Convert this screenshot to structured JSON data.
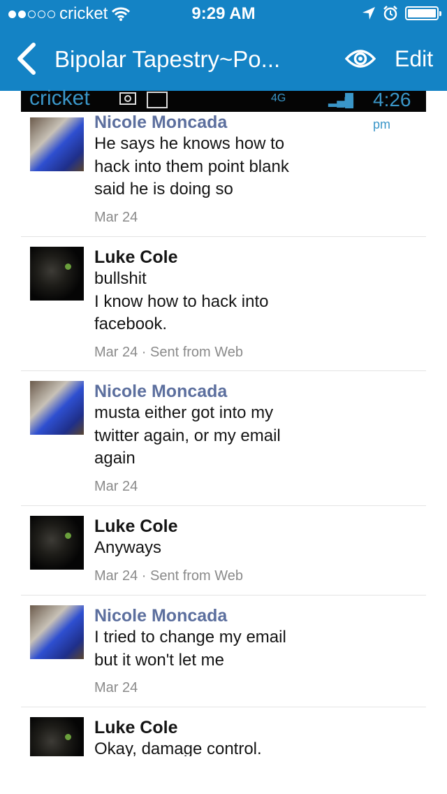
{
  "status_bar": {
    "carrier": "cricket",
    "time": "9:29 AM",
    "signal_dots_filled": 2,
    "signal_dots_total": 5,
    "battery_level": 1.0
  },
  "nav": {
    "title": "Bipolar Tapestry~Po...",
    "edit_label": "Edit"
  },
  "inner_status": {
    "carrier": "cricket",
    "network": "4G",
    "time": "4:26",
    "ampm": "pm"
  },
  "messages": [
    {
      "author": "Nicole Moncada",
      "text": "He says he knows how to\nhack into them point blank\nsaid he is doing so",
      "meta": "Mar 24"
    },
    {
      "author": "Luke Cole",
      "text": "bullshit\nI know how to hack into\nfacebook.",
      "meta": "Mar 24 · Sent from Web"
    },
    {
      "author": "Nicole Moncada",
      "text": "musta either got into my\ntwitter again, or my email\nagain",
      "meta": "Mar 24"
    },
    {
      "author": "Luke Cole",
      "text": "Anyways",
      "meta": "Mar 24 · Sent from Web"
    },
    {
      "author": "Nicole Moncada",
      "text": "I tried to change my email\nbut it won't let me",
      "meta": "Mar 24"
    },
    {
      "author": "Luke Cole",
      "text": "Okay, damage control.",
      "meta": ""
    }
  ],
  "colors": {
    "header": "#1483c5",
    "author_blue": "#5c6f9e",
    "author_dark": "#141414",
    "meta": "#8a8a8a"
  }
}
